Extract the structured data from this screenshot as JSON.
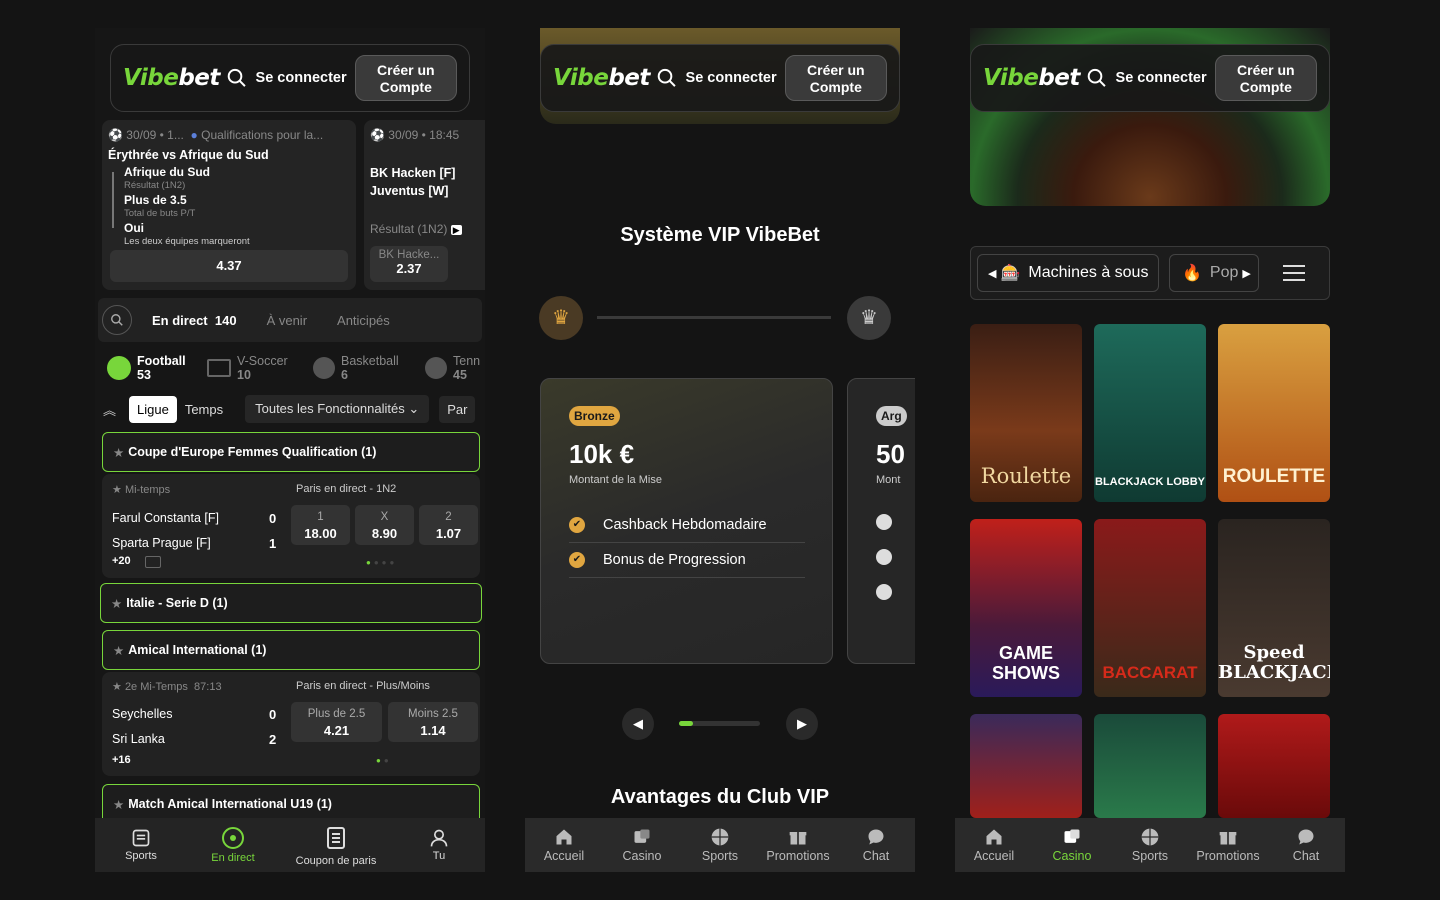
{
  "header": {
    "logo": "Vibebet",
    "login": "Se connecter",
    "create": "Créer un Compte"
  },
  "p1": {
    "bet1": {
      "meta": "30/09 • 1...",
      "comp": "Qualifications pour la...",
      "match": "Érythrée vs Afrique du Sud",
      "sel": [
        {
          "title": "Afrique du Sud",
          "sub": "Résultat (1N2)"
        },
        {
          "title": "Plus de 3.5",
          "sub": "Total de buts P/T"
        },
        {
          "title": "Oui",
          "sub": "Les deux équipes marqueront"
        }
      ],
      "odds": "4.37"
    },
    "bet2": {
      "meta": "30/09 • 18:45",
      "team1": "BK Hacken [F]",
      "team2": "Juventus [W]",
      "market": "Résultat (1N2)",
      "pick": "BK Hacke...",
      "odds": "2.37"
    },
    "tabs": {
      "live": "En direct",
      "count": "140",
      "soon": "À venir",
      "anti": "Anticipés"
    },
    "sports": [
      {
        "name": "Football",
        "count": "53"
      },
      {
        "name": "V-Soccer",
        "count": "10"
      },
      {
        "name": "Basketball",
        "count": "6"
      },
      {
        "name": "Tenn",
        "count": "45"
      }
    ],
    "filters": {
      "ligue": "Ligue",
      "temps": "Temps",
      "all": "Toutes les Fonctionnalités",
      "par": "Par"
    },
    "leagues": [
      "Coupe d'Europe Femmes Qualification (1)",
      "Italie - Serie D (1)",
      "Amical International (1)",
      "Match Amical International U19 (1)"
    ],
    "m1": {
      "status": "Mi-temps",
      "market": "Paris en direct - 1N2",
      "home": "Farul Constanta [F]",
      "away": "Sparta Prague [F]",
      "hs": "0",
      "as": "1",
      "more": "+20",
      "odds": [
        {
          "l": "1",
          "v": "18.00"
        },
        {
          "l": "X",
          "v": "8.90"
        },
        {
          "l": "2",
          "v": "1.07"
        }
      ]
    },
    "m2": {
      "status": "2e Mi-Temps",
      "time": "87:13",
      "market": "Paris en direct - Plus/Moins",
      "home": "Seychelles",
      "away": "Sri Lanka",
      "hs": "0",
      "as": "2",
      "more": "+16",
      "odds": [
        {
          "l": "Plus de",
          "h": "2.5",
          "v": "4.21"
        },
        {
          "l": "Moins",
          "h": "2.5",
          "v": "1.14"
        }
      ]
    },
    "nav": [
      "Sports",
      "En direct",
      "Coupon de paris",
      "Tu"
    ]
  },
  "p2": {
    "title": "Système VIP VibeBet",
    "tier": "Bronze",
    "amount": "10k €",
    "amount_label": "Montant de la Mise",
    "benefits": [
      "Cashback Hebdomadaire",
      "Bonus de Progression"
    ],
    "next_tier": "Arg",
    "next_amount": "50",
    "next_label": "Mont",
    "footer": "Avantages du Club VIP"
  },
  "p3": {
    "cat1": "Machines à sous",
    "cat2": "Pop",
    "tiles": [
      "Roulette",
      "BLACKJACK LOBBY",
      "ROULETTE",
      "GAME SHOWS",
      "BACCARAT",
      "Speed BLACKJACK",
      "",
      "",
      ""
    ]
  },
  "nav2": [
    "Accueil",
    "Casino",
    "Sports",
    "Promotions",
    "Chat"
  ],
  "colors": {
    "accent": "#78d63b",
    "gold": "#e0a640",
    "bg": "#141414"
  }
}
